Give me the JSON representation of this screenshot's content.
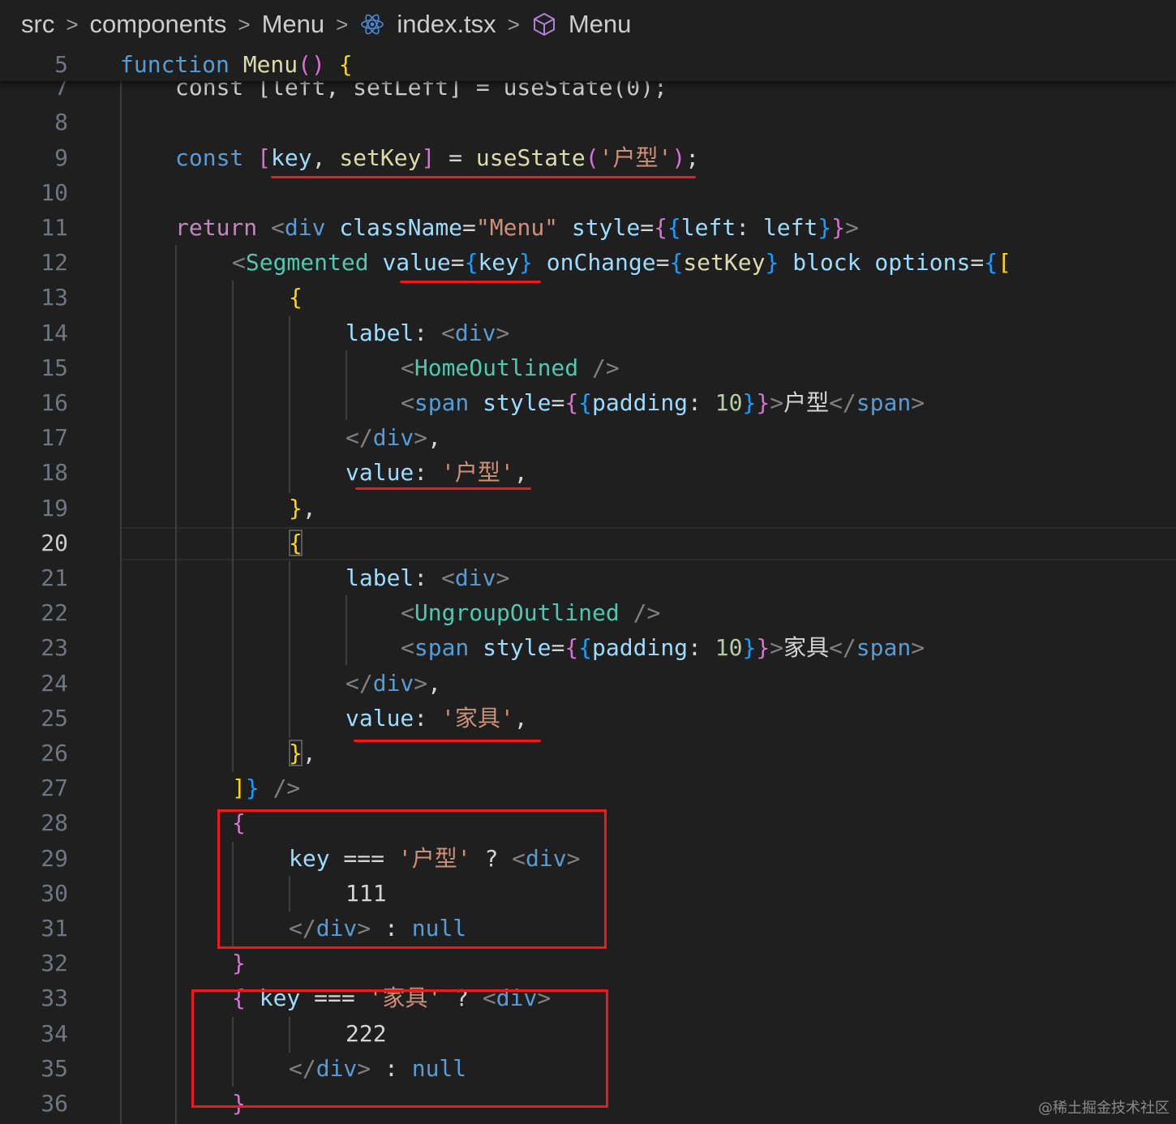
{
  "breadcrumb": [
    "src",
    "components",
    "Menu",
    "index.tsx",
    "Menu"
  ],
  "sticky_line": {
    "number": "5",
    "text": "function Menu() {"
  },
  "partial_line": {
    "number": "7",
    "text": "const [left, setLeft] = useState(0);"
  },
  "active_line": "20",
  "lines": [
    {
      "number": "8",
      "text": ""
    },
    {
      "number": "9",
      "text": "const [key, setKey] = useState('户型');"
    },
    {
      "number": "10",
      "text": ""
    },
    {
      "number": "11",
      "text": "return <div className=\"Menu\" style={{left: left}}>"
    },
    {
      "number": "12",
      "text": "<Segmented value={key} onChange={setKey} block options={["
    },
    {
      "number": "13",
      "text": "{"
    },
    {
      "number": "14",
      "text": "label: <div>"
    },
    {
      "number": "15",
      "text": "<HomeOutlined />"
    },
    {
      "number": "16",
      "text": "<span style={{padding: 10}}>户型</span>"
    },
    {
      "number": "17",
      "text": "</div>,"
    },
    {
      "number": "18",
      "text": "value: '户型',"
    },
    {
      "number": "19",
      "text": "},"
    },
    {
      "number": "20",
      "text": "{"
    },
    {
      "number": "21",
      "text": "label: <div>"
    },
    {
      "number": "22",
      "text": "<UngroupOutlined />"
    },
    {
      "number": "23",
      "text": "<span style={{padding: 10}}>家具</span>"
    },
    {
      "number": "24",
      "text": "</div>,"
    },
    {
      "number": "25",
      "text": "value: '家具',"
    },
    {
      "number": "26",
      "text": "},"
    },
    {
      "number": "27",
      "text": "]} />"
    },
    {
      "number": "28",
      "text": "{"
    },
    {
      "number": "29",
      "text": "key === '户型' ? <div>"
    },
    {
      "number": "30",
      "text": "111"
    },
    {
      "number": "31",
      "text": "</div> : null"
    },
    {
      "number": "32",
      "text": "}"
    },
    {
      "number": "33",
      "text": "{ key === '家具' ? <div>"
    },
    {
      "number": "34",
      "text": "222"
    },
    {
      "number": "35",
      "text": "</div> : null"
    },
    {
      "number": "36",
      "text": "}"
    }
  ],
  "watermark": "@稀土掘金技术社区",
  "colors": {
    "background": "#1f1f1f",
    "keyword": "#569cd6",
    "control": "#c586c0",
    "function": "#dcdcaa",
    "variable": "#9cdcfe",
    "string": "#ce9178",
    "number": "#b5cea8",
    "component": "#4ec9b0",
    "annotation_red": "#f01818"
  }
}
